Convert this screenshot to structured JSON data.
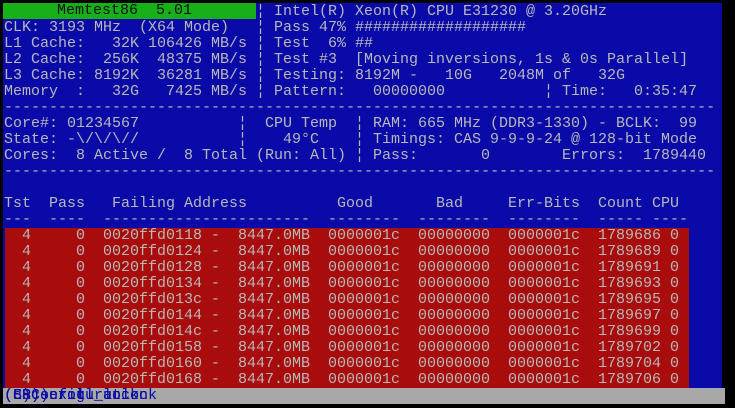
{
  "header": {
    "title": "Memtest86  5.01",
    "cpu": "Intel(R) Xeon(R) CPU E31230 @ 3.20GHz",
    "clk": "CLK: 3193 MHz  (X64 Mode)",
    "pass_progress": "Pass 47% ###################",
    "l1": "L1 Cache:   32K 106426 MB/s",
    "test_progress": "Test  6% ##",
    "l2": "L2 Cache:  256K  48375 MB/s",
    "test_name": "Test #3  [Moving inversions, 1s & 0s Parallel]",
    "l3": "L3 Cache: 8192K  36281 MB/s",
    "testing": "Testing: 8192M -   10G   2048M of   32G",
    "memory": "Memory  :   32G   7425 MB/s",
    "pattern_label": "Pattern:",
    "pattern": "00000000",
    "time_label": "Time:",
    "time": "0:35:47",
    "pass_percent": 47,
    "test_percent": 6
  },
  "sep": "¦",
  "divider": "-------------------------------------------------------------------------------",
  "status": {
    "cores_ids": "Core#: 01234567",
    "cpu_temp_label": "CPU Temp",
    "ram": "RAM: 665 MHz (DDR3-1330) - BCLK:  99",
    "state": "State: -\\/\\/\\//",
    "temp": "49°C",
    "timings": "Timings: CAS 9-9-9-24 @ 128-bit Mode",
    "cores": "Cores:  8 Active /  8 Total (Run: All)",
    "pass_label": "Pass:",
    "pass": "0",
    "errors_label": "Errors:",
    "errors": "1789440"
  },
  "table": {
    "headers": [
      "Tst",
      "Pass",
      "Failing Address",
      "Good",
      "Bad",
      "Err-Bits",
      "Count",
      "CPU"
    ],
    "underlines": [
      "---",
      "----",
      "-----------------------",
      "--------",
      "--------",
      "--------",
      "-----",
      "----"
    ],
    "rows": [
      [
        "4",
        "0",
        "0020ffd0118 -",
        "8447.0MB",
        "0000001c",
        "00000000",
        "0000001c",
        "1789686",
        "0"
      ],
      [
        "4",
        "0",
        "0020ffd0124 -",
        "8447.0MB",
        "0000001c",
        "00000000",
        "0000001c",
        "1789689",
        "0"
      ],
      [
        "4",
        "0",
        "0020ffd0128 -",
        "8447.0MB",
        "0000001c",
        "00000000",
        "0000001c",
        "1789691",
        "0"
      ],
      [
        "4",
        "0",
        "0020ffd0134 -",
        "8447.0MB",
        "0000001c",
        "00000000",
        "0000001c",
        "1789693",
        "0"
      ],
      [
        "4",
        "0",
        "0020ffd013c -",
        "8447.0MB",
        "0000001c",
        "00000000",
        "0000001c",
        "1789695",
        "0"
      ],
      [
        "4",
        "0",
        "0020ffd0144 -",
        "8447.0MB",
        "0000001c",
        "00000000",
        "0000001c",
        "1789697",
        "0"
      ],
      [
        "4",
        "0",
        "0020ffd014c -",
        "8447.0MB",
        "0000001c",
        "00000000",
        "0000001c",
        "1789699",
        "0"
      ],
      [
        "4",
        "0",
        "0020ffd0158 -",
        "8447.0MB",
        "0000001c",
        "00000000",
        "0000001c",
        "1789702",
        "0"
      ],
      [
        "4",
        "0",
        "0020ffd0160 -",
        "8447.0MB",
        "0000001c",
        "00000000",
        "0000001c",
        "1789704",
        "0"
      ],
      [
        "4",
        "0",
        "0020ffd0168 -",
        "8447.0MB",
        "0000001c",
        "00000000",
        "0000001c",
        "1789706",
        "0"
      ]
    ]
  },
  "footer": {
    "exit": "(ESC)exit",
    "config": "(c)configuration",
    "scroll_lock": "(SP)scroll_lock",
    "scroll_unlock": "(CR)scroll_unlock"
  }
}
